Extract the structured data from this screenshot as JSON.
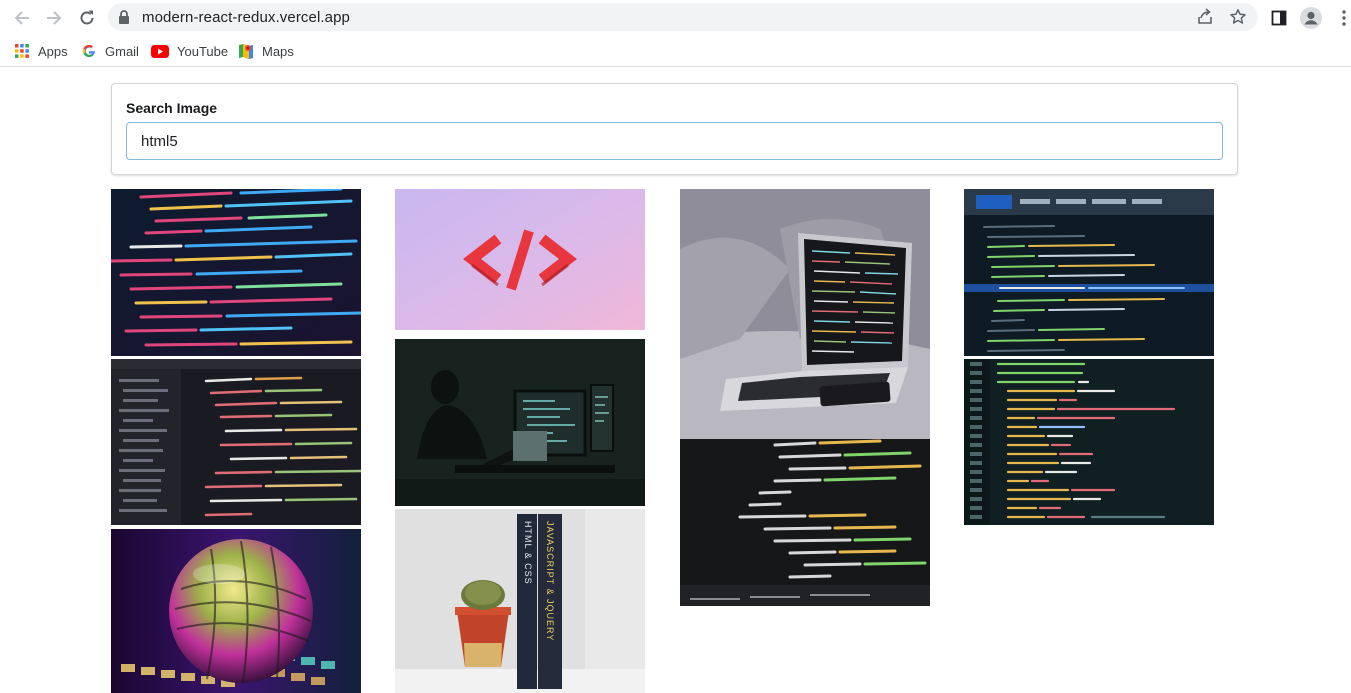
{
  "browser": {
    "url": "modern-react-redux.vercel.app",
    "bookmarks": [
      {
        "label": "Apps",
        "icon": "apps-grid-icon"
      },
      {
        "label": "Gmail",
        "icon": "google-icon"
      },
      {
        "label": "YouTube",
        "icon": "youtube-icon"
      },
      {
        "label": "Maps",
        "icon": "maps-icon"
      }
    ]
  },
  "search": {
    "label": "Search Image",
    "value": "html5"
  },
  "gallery": {
    "images": [
      {
        "name": "code-screen-pink-blue"
      },
      {
        "name": "code-editor-dark"
      },
      {
        "name": "crystal-ball-keyboard"
      },
      {
        "name": "code-symbol-pink"
      },
      {
        "name": "developer-dark-room"
      },
      {
        "name": "books-and-cactus"
      },
      {
        "name": "laptop-on-couch"
      },
      {
        "name": "html-code-closeup"
      },
      {
        "name": "devtools-inspector"
      },
      {
        "name": "css-code-screen"
      }
    ],
    "book_titles": [
      "HTML & CSS",
      "JAVASCRIPT & JQUERY"
    ]
  }
}
